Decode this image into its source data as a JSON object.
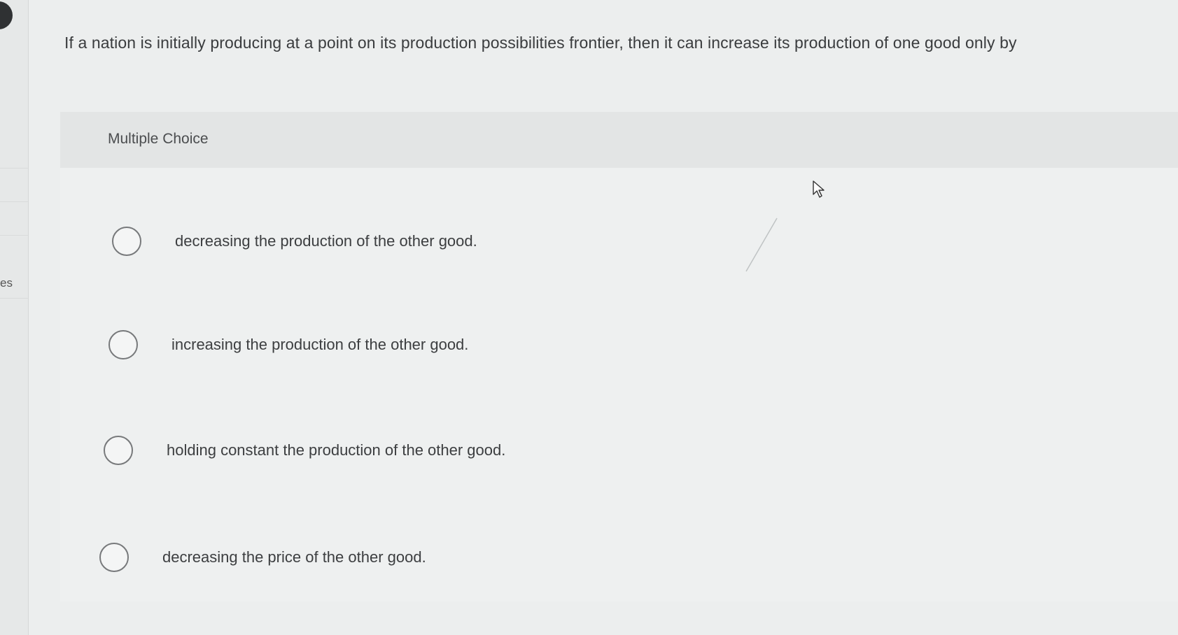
{
  "question": {
    "text": "If a nation is initially producing at a point on its production possibilities frontier, then it can increase its production of one good only by"
  },
  "multiple_choice": {
    "label": "Multiple Choice",
    "options": [
      {
        "label": "decreasing the production of the other good."
      },
      {
        "label": "increasing the production of the other good."
      },
      {
        "label": "holding constant the production of the other good."
      },
      {
        "label": "decreasing the price of the other good."
      }
    ]
  },
  "left_rail": {
    "partial_text": "es"
  },
  "icons": {
    "radio": "radio-button-icon",
    "cursor": "mouse-pointer-icon"
  },
  "colors": {
    "background": "#eceeee",
    "header_band": "#e3e5e5",
    "text": "#3a3c3e",
    "radio_border": "#77797b"
  }
}
